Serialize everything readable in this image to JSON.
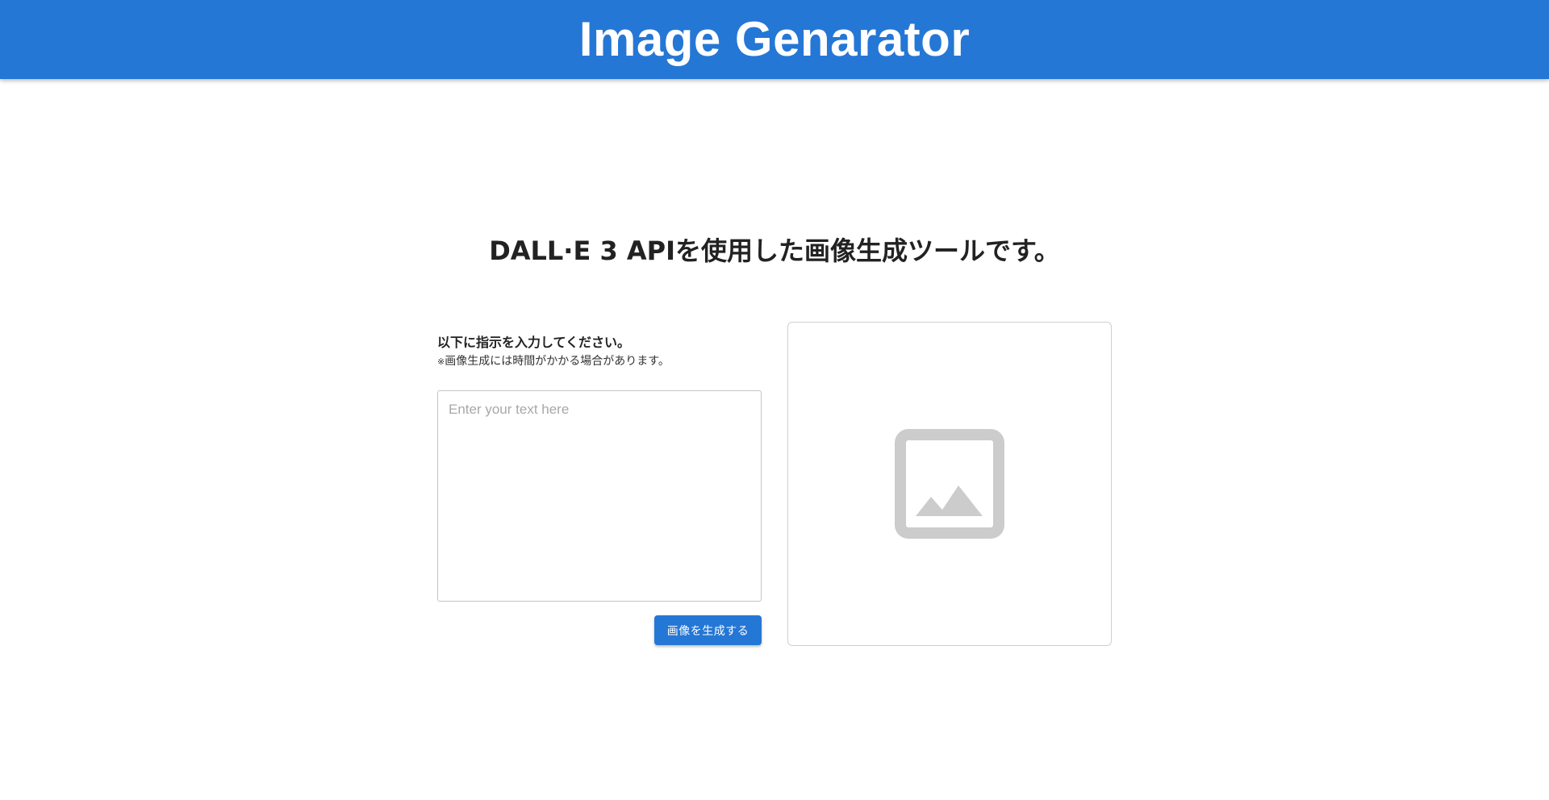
{
  "header": {
    "title": "Image Genarator",
    "background_color": "#2577d5"
  },
  "main": {
    "heading": "DALL·E 3 APIを使用した画像生成ツールです。",
    "form": {
      "label": "以下に指示を入力してください。",
      "note_mark": "※",
      "note": "画像生成には時間がかかる場合があります。",
      "input_placeholder": "Enter your text here",
      "input_value": "",
      "submit_label": "画像を生成する"
    },
    "preview": {
      "icon": "image-placeholder-icon",
      "icon_color": "#cccccc"
    }
  }
}
